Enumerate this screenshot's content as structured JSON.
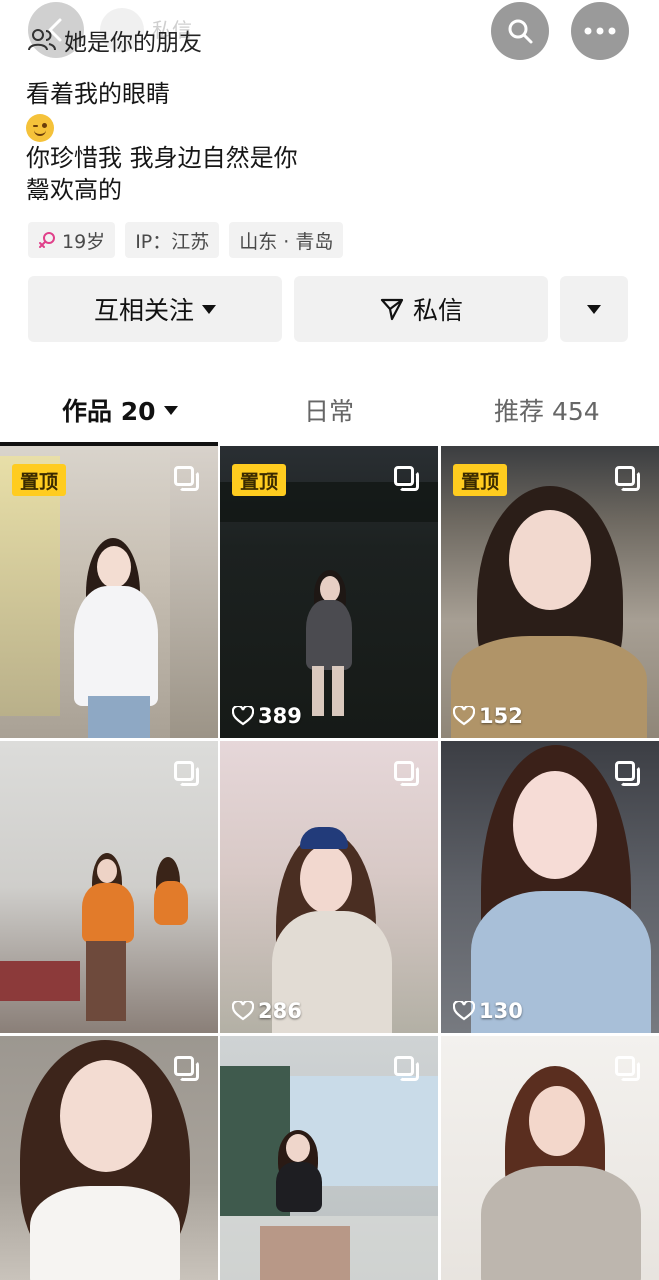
{
  "header": {
    "friend_label": "她是你的朋友",
    "ghost_name": "私信",
    "icons": {
      "back": "chevron-left-icon",
      "search": "search-icon",
      "more": "more-icon",
      "friend": "users-icon"
    }
  },
  "bio": {
    "lines": [
      "看着我的眼睛",
      "你珍惜我 我身边自然是你",
      "鬶欢高的"
    ]
  },
  "tags": {
    "age": "19岁",
    "ip": "IP：江苏",
    "location": "山东 · 青岛",
    "gender_color": "#e0408a"
  },
  "actions": {
    "follow": "互相关注",
    "message": "私信"
  },
  "tabs": {
    "works": "作品 20",
    "daily": "日常",
    "recommend": "推荐 454"
  },
  "grid": {
    "pin_label": "置顶",
    "items": [
      {
        "pinned": true,
        "likes": ""
      },
      {
        "pinned": true,
        "likes": "389"
      },
      {
        "pinned": true,
        "likes": "152"
      },
      {
        "pinned": false,
        "likes": ""
      },
      {
        "pinned": false,
        "likes": "286"
      },
      {
        "pinned": false,
        "likes": "130"
      },
      {
        "pinned": false,
        "likes": ""
      },
      {
        "pinned": false,
        "likes": ""
      },
      {
        "pinned": false,
        "likes": ""
      }
    ]
  },
  "colors": {
    "accent_yellow": "#ffcc1f",
    "button_bg": "#f1f1f1"
  }
}
